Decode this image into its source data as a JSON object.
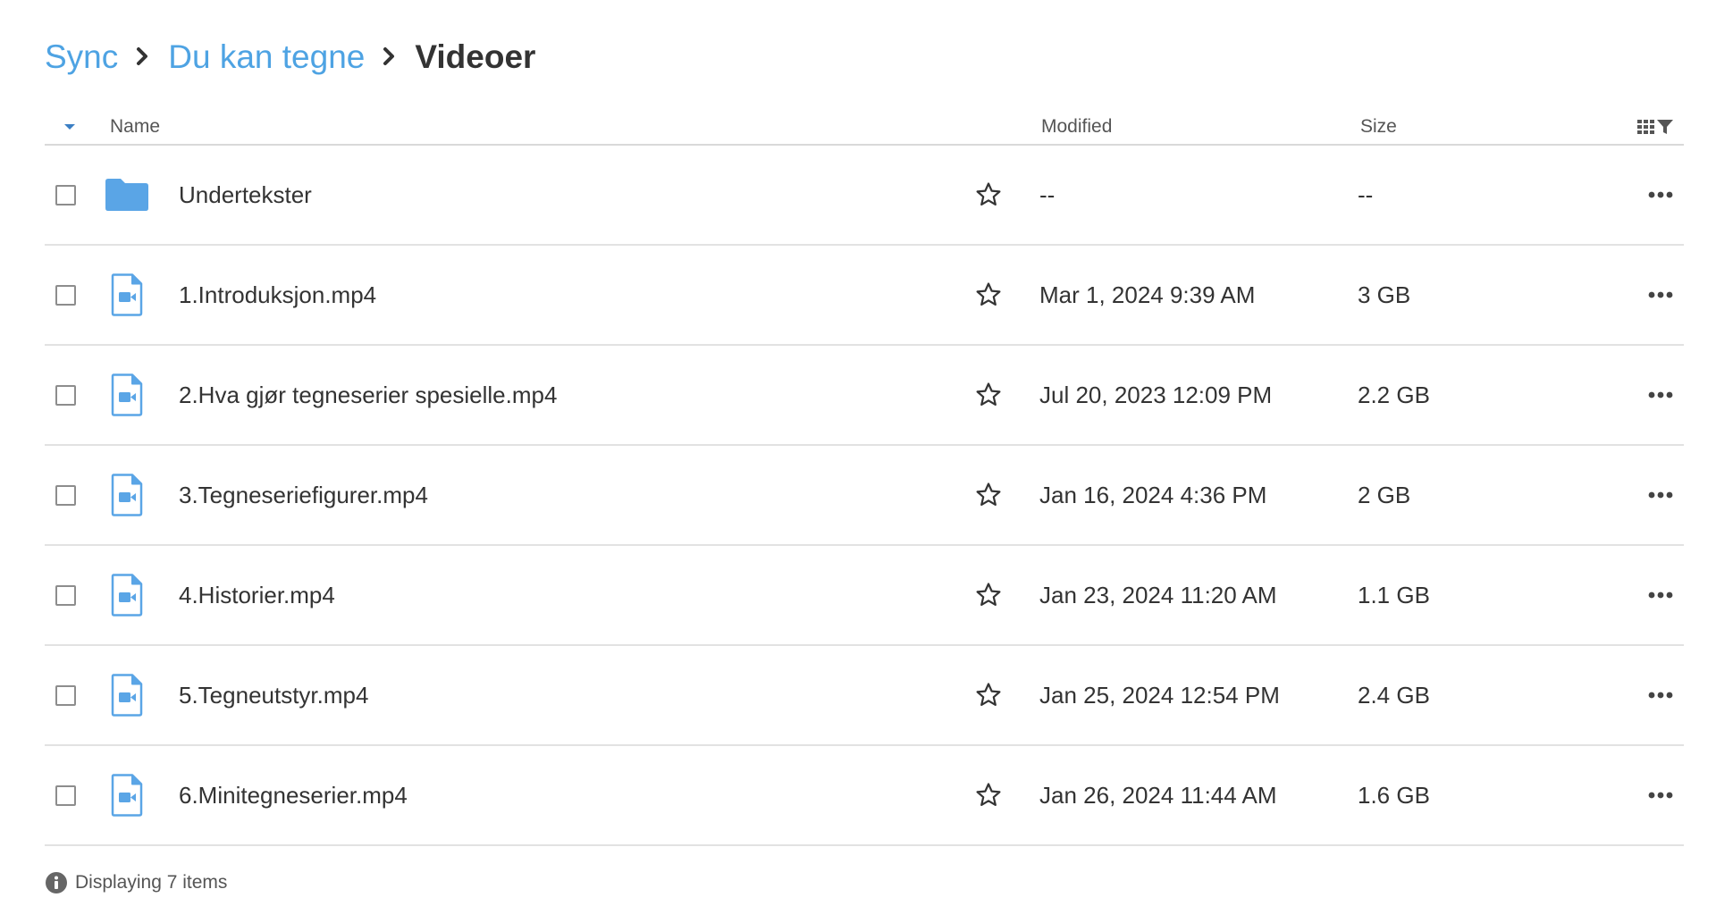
{
  "breadcrumb": {
    "items": [
      {
        "label": "Sync"
      },
      {
        "label": "Du kan tegne"
      }
    ],
    "current": "Videoer"
  },
  "table": {
    "headers": {
      "name": "Name",
      "modified": "Modified",
      "size": "Size"
    },
    "rows": [
      {
        "type": "folder",
        "name": "Undertekster",
        "modified": "--",
        "size": "--"
      },
      {
        "type": "video",
        "name": "1.Introduksjon.mp4",
        "modified": "Mar 1, 2024 9:39 AM",
        "size": "3 GB"
      },
      {
        "type": "video",
        "name": "2.Hva gjør tegneserier spesielle.mp4",
        "modified": "Jul 20, 2023 12:09 PM",
        "size": "2.2 GB"
      },
      {
        "type": "video",
        "name": "3.Tegneseriefigurer.mp4",
        "modified": "Jan 16, 2024 4:36 PM",
        "size": "2 GB"
      },
      {
        "type": "video",
        "name": "4.Historier.mp4",
        "modified": "Jan 23, 2024 11:20 AM",
        "size": "1.1 GB"
      },
      {
        "type": "video",
        "name": "5.Tegneutstyr.mp4",
        "modified": "Jan 25, 2024 12:54 PM",
        "size": "2.4 GB"
      },
      {
        "type": "video",
        "name": "6.Minitegneserier.mp4",
        "modified": "Jan 26, 2024 11:44 AM",
        "size": "1.6 GB"
      }
    ]
  },
  "footer": {
    "status": "Displaying 7 items"
  },
  "colors": {
    "accent": "#4ea3e3",
    "folder": "#5aa5e6",
    "file_outline": "#5aa5e6",
    "text": "#333333",
    "muted": "#555555",
    "divider": "#e2e2e2"
  },
  "icons": {
    "folder": "folder-icon",
    "video": "video-file-icon",
    "star": "star-outline-icon",
    "more": "more-horizontal-icon",
    "sort": "sort-caret-down-icon",
    "columns": "column-filter-icon",
    "info": "info-icon",
    "separator": "chevron-right-icon"
  }
}
